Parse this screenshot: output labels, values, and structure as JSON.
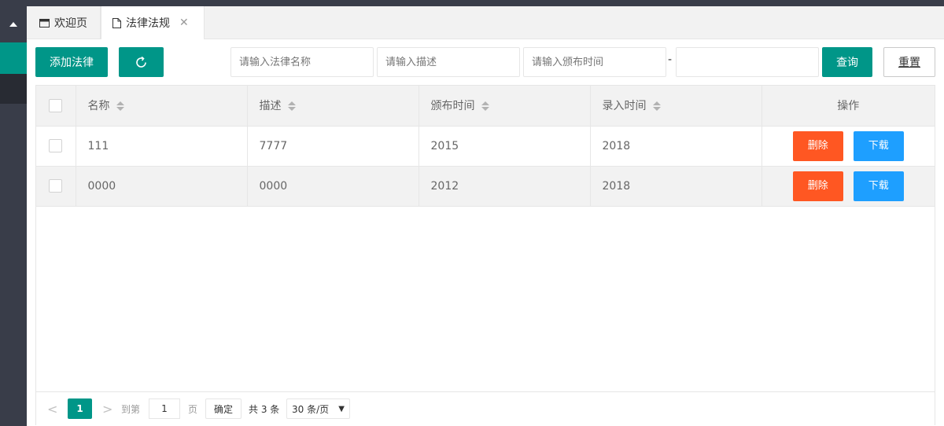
{
  "tabs": [
    {
      "label": "欢迎页",
      "icon": "window-icon"
    },
    {
      "label": "法律法规",
      "icon": "document-icon",
      "closable": true
    }
  ],
  "toolbar": {
    "add_label": "添加法律",
    "refresh_icon": "refresh-icon",
    "name_placeholder": "请输入法律名称",
    "desc_placeholder": "请输入描述",
    "date_placeholder": "请输入颁布时间",
    "range_sep": "-",
    "query_label": "查询",
    "reset_label": "重置"
  },
  "table": {
    "headers": [
      "名称",
      "描述",
      "颁布时间",
      "录入时间",
      "操作"
    ],
    "rows": [
      {
        "name": "111",
        "desc": "7777",
        "issued": "2015",
        "entered": "2018"
      },
      {
        "name": "0000",
        "desc": "0000",
        "issued": "2012",
        "entered": "2018"
      }
    ],
    "delete_label": "删除",
    "download_label": "下载"
  },
  "pager": {
    "prev": "<",
    "current": "1",
    "next": ">",
    "goto_label": "到第",
    "goto_value": "1",
    "page_label": "页",
    "confirm_label": "确定",
    "total_label": "共 3 条",
    "page_size": "30 条/页"
  },
  "colors": {
    "primary": "#009688",
    "danger": "#ff5722",
    "info": "#1e9fff",
    "sidebar": "#393d49"
  }
}
